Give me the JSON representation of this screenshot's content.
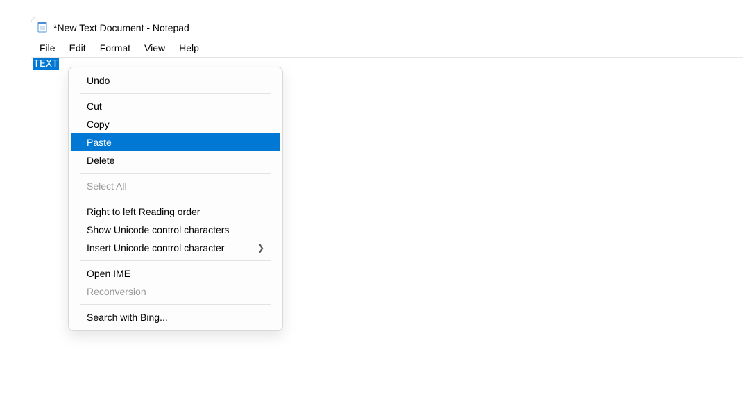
{
  "window": {
    "title": "*New Text Document - Notepad"
  },
  "menubar": {
    "file": "File",
    "edit": "Edit",
    "format": "Format",
    "view": "View",
    "help": "Help"
  },
  "editor": {
    "selected_text": "TEXT"
  },
  "context_menu": {
    "undo": "Undo",
    "cut": "Cut",
    "copy": "Copy",
    "paste": "Paste",
    "delete": "Delete",
    "select_all": "Select All",
    "rtl": "Right to left Reading order",
    "show_unicode": "Show Unicode control characters",
    "insert_unicode": "Insert Unicode control character",
    "open_ime": "Open IME",
    "reconversion": "Reconversion",
    "search_bing": "Search with Bing..."
  }
}
